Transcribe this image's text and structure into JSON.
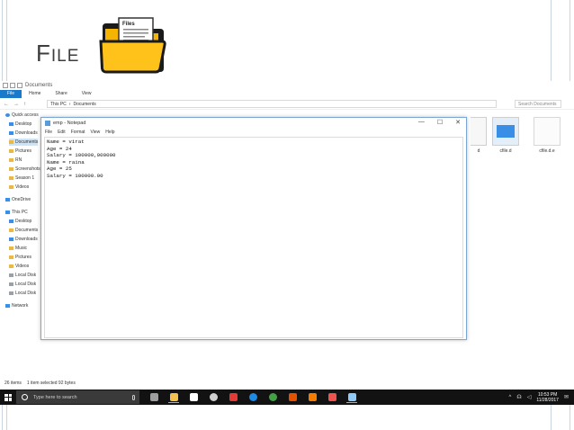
{
  "slide": {
    "title_cap": "F",
    "title_rest": "ILE",
    "folder_label": "Files"
  },
  "explorer": {
    "title": "Documents",
    "ribbon_tabs": [
      "File",
      "Home",
      "Share",
      "View"
    ],
    "path": [
      "This PC",
      "Documents"
    ],
    "search_placeholder": "Search Documents",
    "nav": [
      {
        "label": "Quick access",
        "kind": "star",
        "top": true
      },
      {
        "label": "Desktop",
        "kind": "blue"
      },
      {
        "label": "Downloads",
        "kind": "blue"
      },
      {
        "label": "Documents",
        "kind": "folder",
        "selected": true
      },
      {
        "label": "Pictures",
        "kind": "folder"
      },
      {
        "label": "RN",
        "kind": "folder"
      },
      {
        "label": "Screenshots",
        "kind": "folder"
      },
      {
        "label": "Season 1",
        "kind": "folder"
      },
      {
        "label": "Videos",
        "kind": "folder"
      },
      {
        "label": "OneDrive",
        "kind": "blue",
        "top": true
      },
      {
        "label": "This PC",
        "kind": "blue",
        "top": true
      },
      {
        "label": "Desktop",
        "kind": "blue"
      },
      {
        "label": "Documents",
        "kind": "folder"
      },
      {
        "label": "Downloads",
        "kind": "blue"
      },
      {
        "label": "Music",
        "kind": "folder"
      },
      {
        "label": "Pictures",
        "kind": "folder"
      },
      {
        "label": "Videos",
        "kind": "folder"
      },
      {
        "label": "Local Disk",
        "kind": "grey"
      },
      {
        "label": "Local Disk",
        "kind": "grey"
      },
      {
        "label": "Local Disk",
        "kind": "grey"
      },
      {
        "label": "Network",
        "kind": "blue",
        "top": true
      }
    ],
    "files": [
      {
        "name": "d",
        "kind": "partial"
      },
      {
        "name": "cfile.d",
        "kind": "scr"
      },
      {
        "name": "cfile.d.e",
        "kind": "doc"
      }
    ],
    "status": {
      "items": "26 items",
      "selected": "1 item selected  92 bytes"
    }
  },
  "notepad": {
    "title": "emp - Notepad",
    "menu": [
      "File",
      "Edit",
      "Format",
      "View",
      "Help"
    ],
    "controls": [
      "—",
      "☐",
      "✕"
    ],
    "lines": [
      "Name = virat",
      "Age = 24",
      "Salary = 100000,000000",
      "Name = raina",
      "Age = 25",
      "Salary = 100000.00"
    ]
  },
  "taskbar": {
    "search_placeholder": "Type here to search",
    "clock_time": "10:53 PM",
    "clock_date": "11/28/2017",
    "tray_icons": [
      "^",
      "☊",
      "◁",
      "✉"
    ],
    "apps": [
      {
        "name": "task-view-icon",
        "color": "#9e9e9e"
      },
      {
        "name": "file-explorer-icon",
        "color": "#f2c14e",
        "active": true
      },
      {
        "name": "store-icon",
        "color": "#ffffff"
      },
      {
        "name": "settings-icon",
        "color": "#cfcfcf"
      },
      {
        "name": "media-icon",
        "color": "#e53935"
      },
      {
        "name": "skype-icon",
        "color": "#1e88e5"
      },
      {
        "name": "chrome-icon",
        "color": "#43a047"
      },
      {
        "name": "office-icon",
        "color": "#e65100"
      },
      {
        "name": "paint-icon",
        "color": "#f57c00"
      },
      {
        "name": "photos-icon",
        "color": "#ef5350"
      },
      {
        "name": "notepad-icon",
        "color": "#90caf9",
        "active": true
      }
    ]
  }
}
